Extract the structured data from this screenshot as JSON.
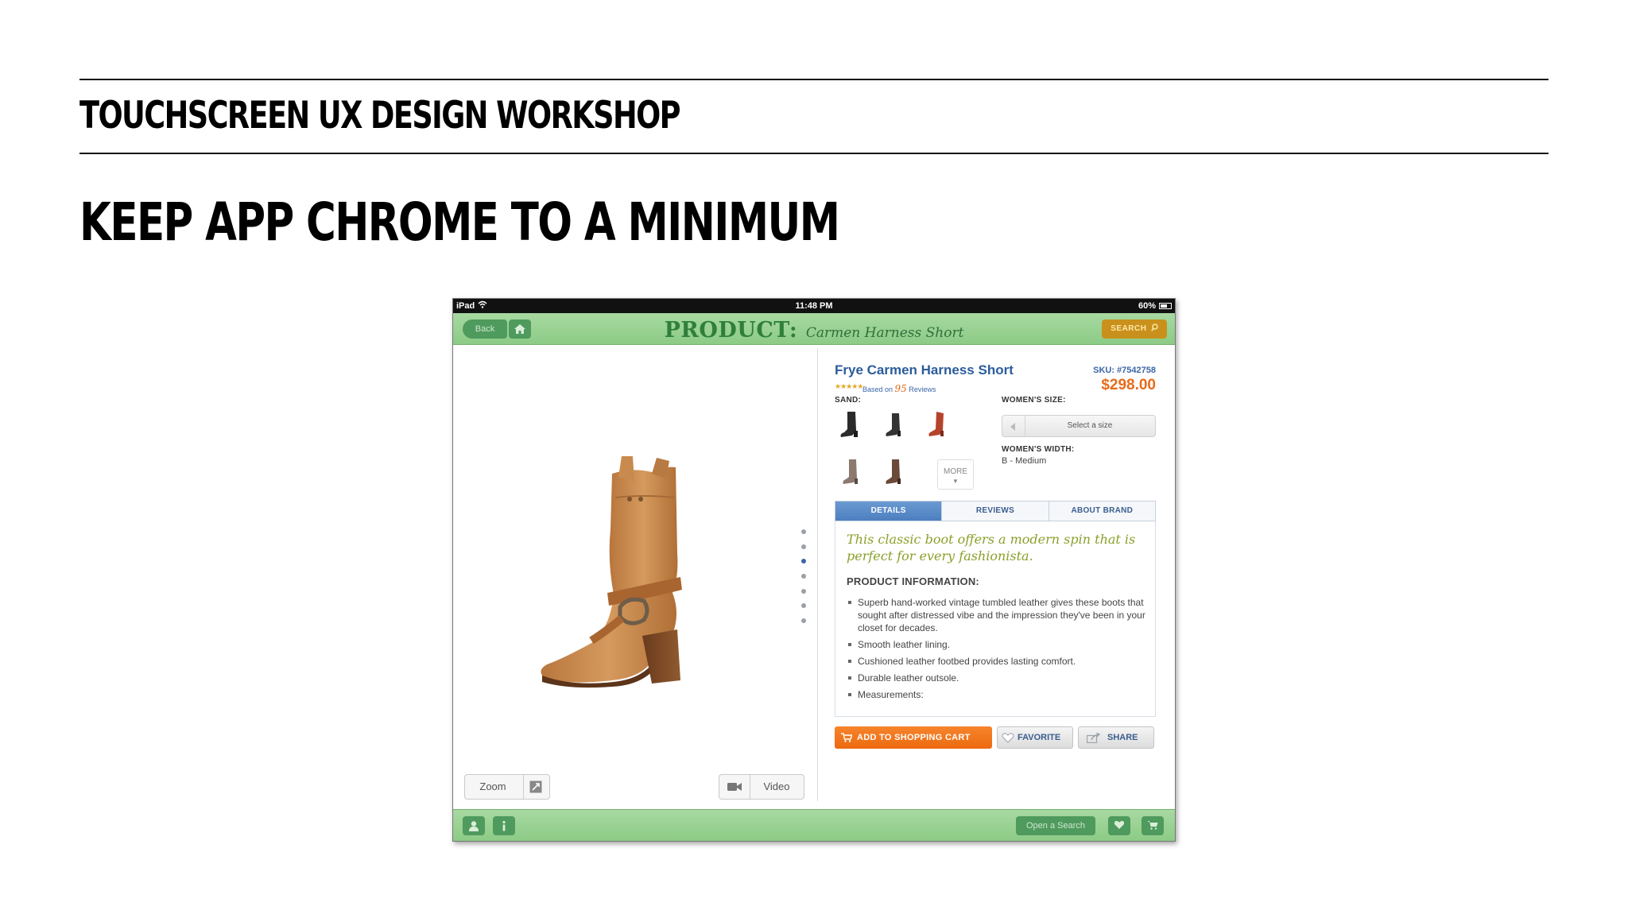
{
  "slide": {
    "workshop_title": "TOUCHSCREEN UX DESIGN WORKSHOP",
    "headline": "KEEP APP CHROME TO A MINIMUM"
  },
  "status_bar": {
    "device": "iPad",
    "time": "11:48 PM",
    "battery": "60%"
  },
  "top_bar": {
    "back_label": "Back",
    "title_main": "PRODUCT:",
    "title_sub": "Carmen Harness Short",
    "search_label": "SEARCH"
  },
  "gallery": {
    "zoom_label": "Zoom",
    "video_label": "Video",
    "image_count": 7,
    "active_index": 2
  },
  "product": {
    "name": "Frye Carmen Harness Short",
    "rating_stars": "★★★★★",
    "rating_value": 5,
    "reviews_prefix": "Based on",
    "reviews_count": "95",
    "reviews_suffix": "Reviews",
    "sku": "SKU: #7542758",
    "price": "$298.00"
  },
  "options": {
    "color_label": "SAND:",
    "more_label": "MORE",
    "size_label": "WOMEN'S SIZE:",
    "size_placeholder": "Select a size",
    "width_label": "WOMEN'S WIDTH:",
    "width_value": "B - Medium"
  },
  "tabs": [
    "DETAILS",
    "REVIEWS",
    "ABOUT BRAND"
  ],
  "details": {
    "tagline": "This classic boot offers a modern spin that is perfect for every fashionista.",
    "info_heading": "PRODUCT INFORMATION:",
    "bullets": [
      "Superb hand-worked vintage tumbled leather gives these boots that sought after distressed vibe and the impression they've been in your closet for decades.",
      "Smooth leather lining.",
      "Cushioned leather footbed provides lasting comfort.",
      "Durable leather outsole.",
      "Measurements:"
    ]
  },
  "actions": {
    "cart_label": "ADD TO SHOPPING CART",
    "favorite_label": "FAVORITE",
    "share_label": "SHARE"
  },
  "bottom_bar": {
    "open_search_label": "Open a Search"
  },
  "colors": {
    "bar_green": "#8ccb86",
    "button_green": "#4f9a5d",
    "title_green": "#2f7f3b",
    "link_blue": "#2b5c9c",
    "price_orange": "#e86b1a",
    "search_gold": "#c9911c"
  }
}
